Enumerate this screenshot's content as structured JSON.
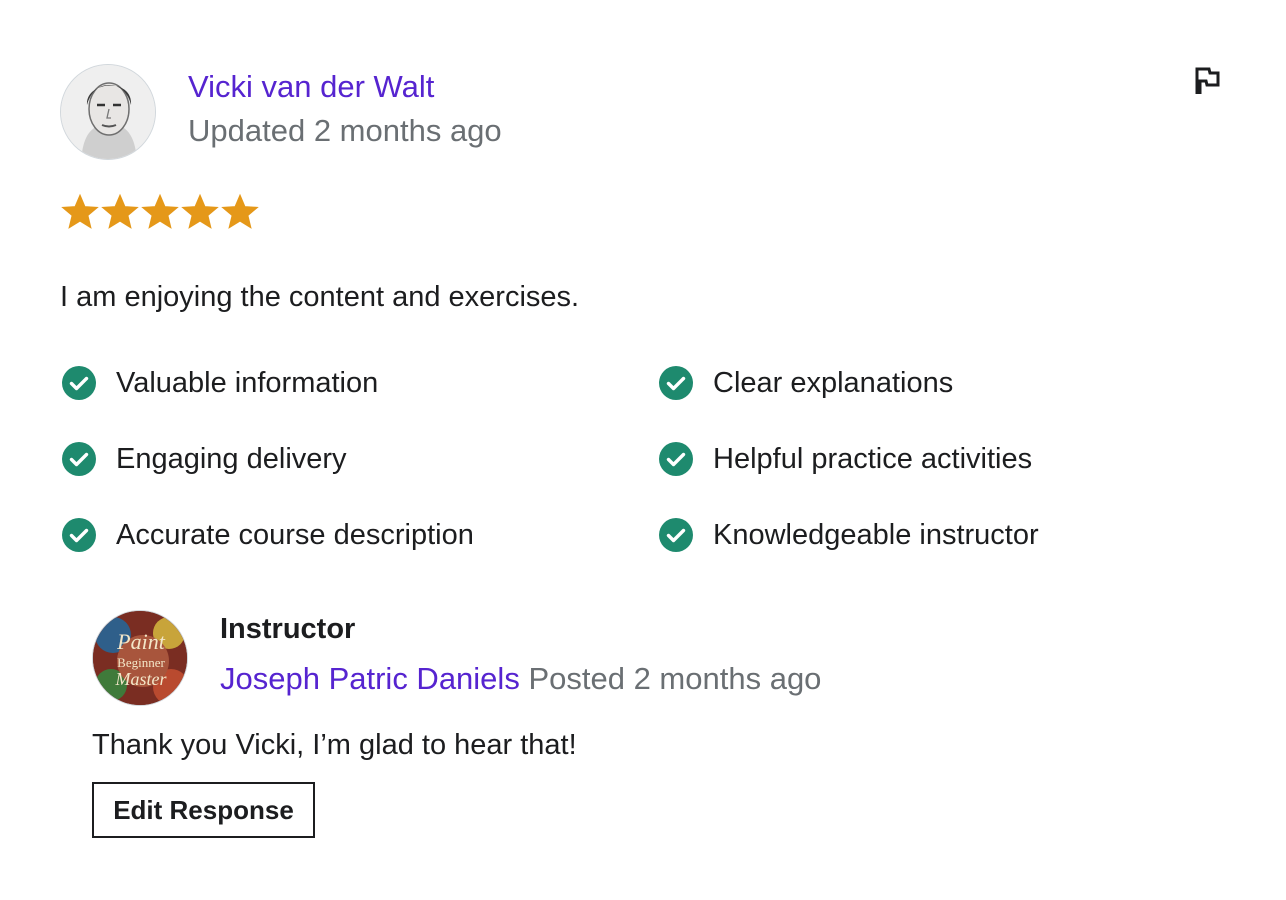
{
  "review": {
    "author": "Vicki van der Walt",
    "updated": "Updated 2 months ago",
    "rating": 5,
    "rating_max": 5,
    "text": "I am enjoying the content and exercises.",
    "tags": [
      "Valuable information",
      "Clear explanations",
      "Engaging delivery",
      "Helpful practice activities",
      "Accurate course description",
      "Knowledgeable instructor"
    ]
  },
  "response": {
    "role": "Instructor",
    "author": "Joseph Patric Daniels",
    "posted": "Posted 2 months ago",
    "text": "Thank you Vicki, I’m glad to hear that!",
    "edit_label": "Edit Response",
    "avatar_logo_text": [
      "Paint",
      "Beginner",
      "Master"
    ]
  },
  "icons": {
    "flag": "flag-icon",
    "star": "star-icon",
    "check": "check-circle-icon"
  },
  "colors": {
    "link": "#5624d0",
    "muted": "#6a6f73",
    "star": "#e59819",
    "check": "#1e8a6e",
    "text": "#1c1d1f"
  }
}
